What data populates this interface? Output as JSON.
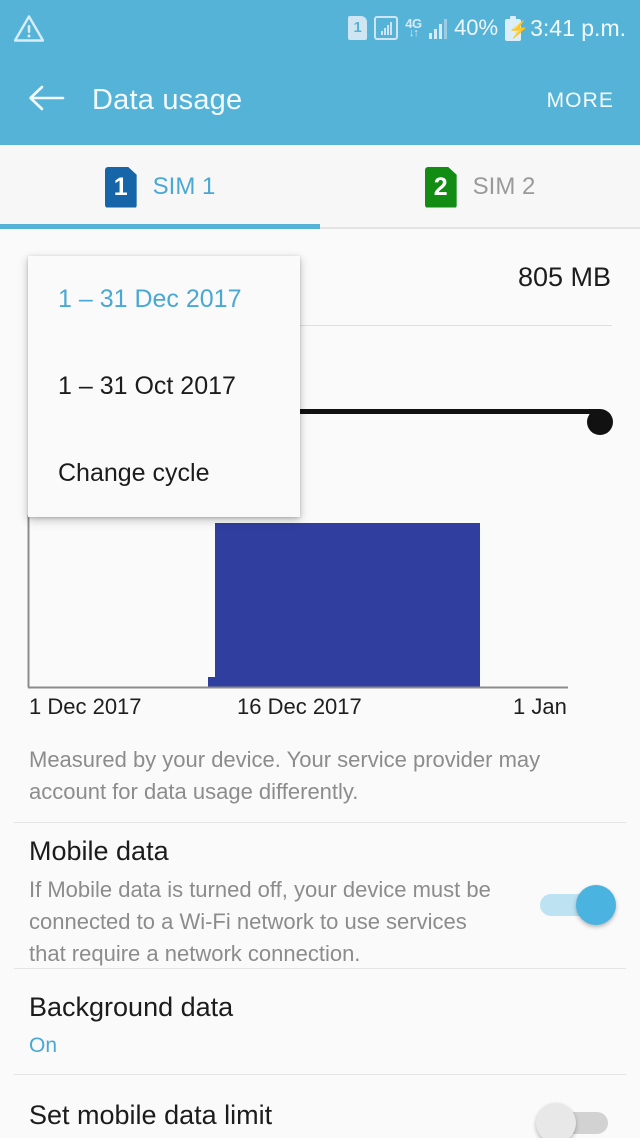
{
  "statusbar": {
    "warning_icon": "warning-triangle-icon",
    "sim_badge": "1",
    "signal_box_icon": "signal-box-icon",
    "network_type": "4G",
    "network_arrows": "↓↑",
    "signal_icon": "signal-bars-icon",
    "battery_percent": "40%",
    "battery_icon": "battery-charging-icon",
    "time": "3:41 p.m."
  },
  "actionbar": {
    "back_icon": "back-arrow-icon",
    "title": "Data usage",
    "more_label": "MORE"
  },
  "tabs": [
    {
      "badge": "1",
      "label": "SIM 1",
      "active": true
    },
    {
      "badge": "2",
      "label": "SIM 2",
      "active": false
    }
  ],
  "usage": {
    "total": "805 MB"
  },
  "dropdown": {
    "items": [
      {
        "label": "1 – 31 Dec 2017",
        "selected": true
      },
      {
        "label": "1 – 31 Oct 2017",
        "selected": false
      },
      {
        "label": "Change cycle",
        "selected": false
      }
    ]
  },
  "chart_data": {
    "type": "area",
    "title": "",
    "xlabel": "",
    "ylabel": "",
    "x_tick_labels": [
      "1 Dec 2017",
      "16 Dec 2017",
      "1 Jan"
    ],
    "x_tick_positions": [
      0,
      0.5,
      1.0
    ],
    "grid": false,
    "legend": null,
    "series": [
      {
        "name": "Data used",
        "type": "area",
        "color": "#303f9f",
        "x": [
          0.0,
          0.33,
          0.335,
          0.34,
          0.84
        ],
        "values": [
          0,
          0,
          0.02,
          0.94,
          0.94
        ],
        "note": "Cumulative mobile data usage area, flat until ~16 Dec then rises to plateau"
      },
      {
        "name": "Data limit",
        "type": "threshold-line",
        "color": "#000000",
        "y": 1.6,
        "handle_position": "right",
        "note": "Horizontal limit line above the usage area with a round drag handle at the right end"
      }
    ],
    "y_axis": {
      "visible": true,
      "ticks": []
    },
    "total_label": "805 MB"
  },
  "info": {
    "text": "Measured by your device. Your service provider may account for data usage differently."
  },
  "settings": [
    {
      "name": "mobile-data",
      "title": "Mobile data",
      "subtitle": "If Mobile data is turned off, your device must be connected to a Wi-Fi network to use services that require a network connection.",
      "toggle": "on"
    },
    {
      "name": "background-data",
      "title": "Background data",
      "subtitle": "On",
      "toggle": null
    },
    {
      "name": "set-mobile-data-limit",
      "title": "Set mobile data limit",
      "subtitle": null,
      "toggle": "off"
    }
  ]
}
